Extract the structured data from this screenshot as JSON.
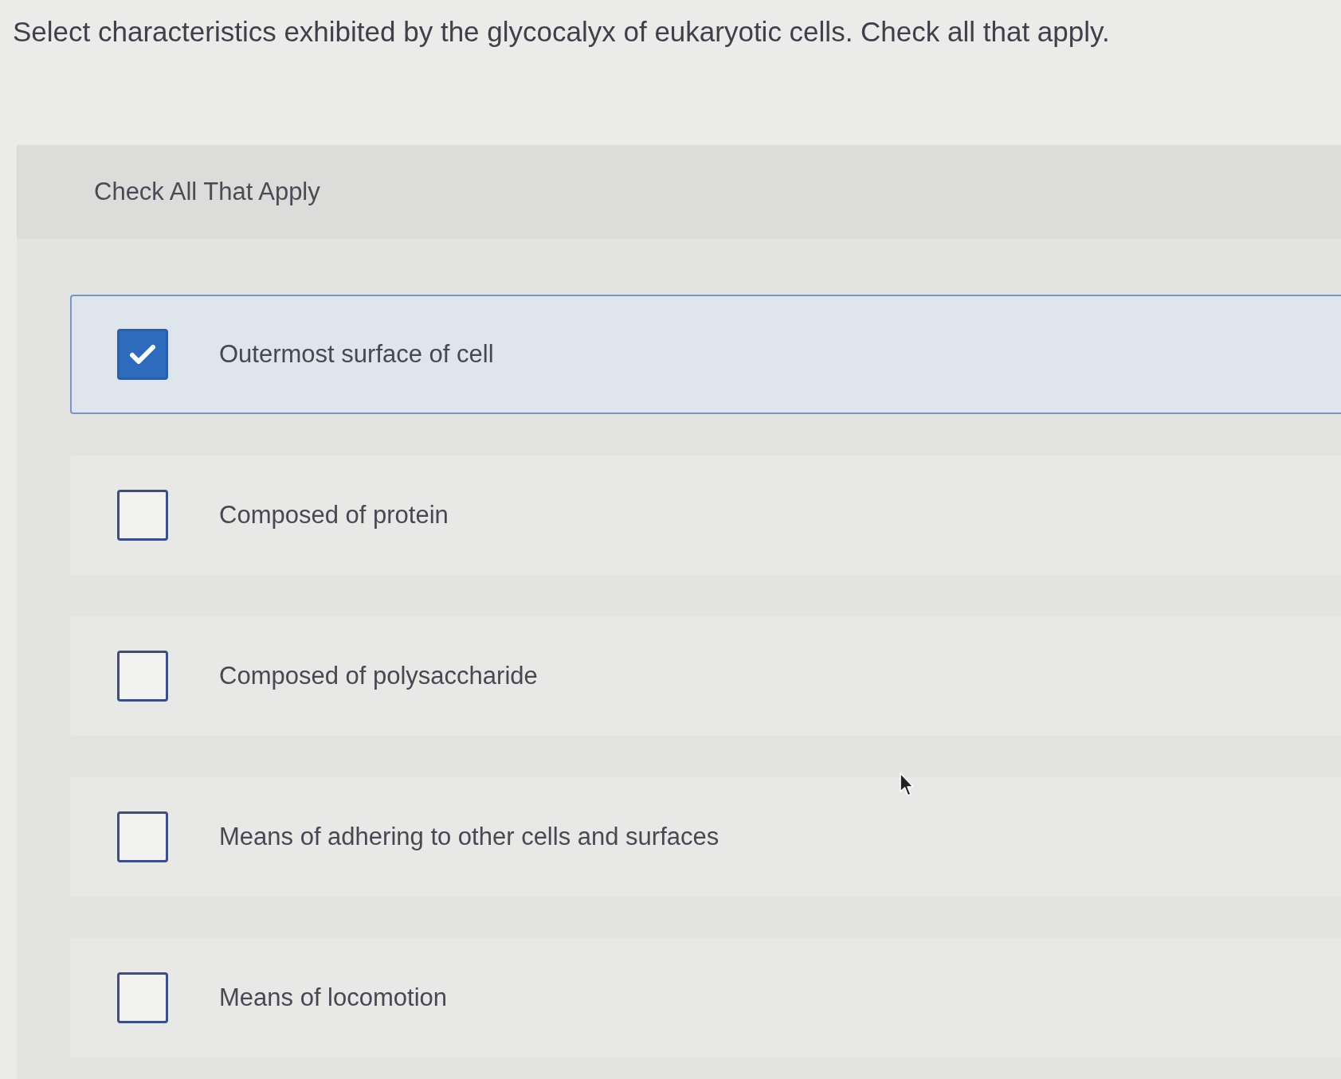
{
  "question": "Select characteristics exhibited by the glycocalyx of eukaryotic cells. Check all that apply.",
  "instruction": "Check All That Apply",
  "options": [
    {
      "label": "Outermost surface of cell",
      "checked": true
    },
    {
      "label": "Composed of protein",
      "checked": false
    },
    {
      "label": "Composed of polysaccharide",
      "checked": false
    },
    {
      "label": "Means of adhering to other cells and surfaces",
      "checked": false
    },
    {
      "label": "Means of locomotion",
      "checked": false
    }
  ]
}
